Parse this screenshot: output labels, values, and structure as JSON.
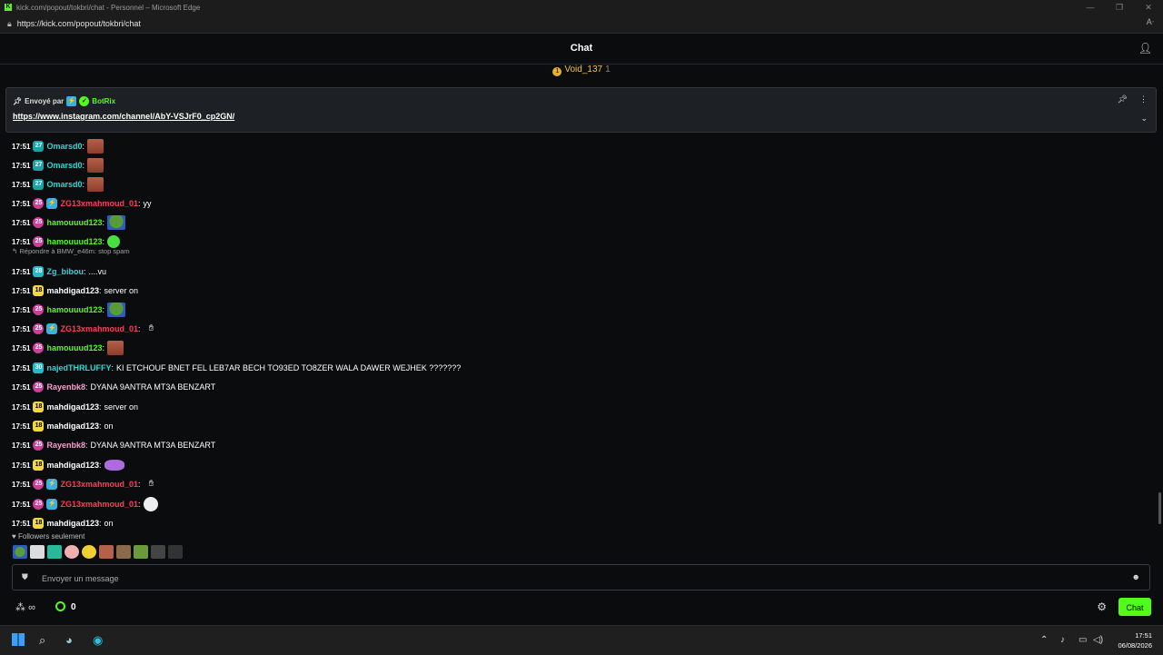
{
  "window": {
    "title": "kick.com/popout/tokbri/chat - Personnel – Microsoft Edge",
    "url": "https://kick.com/popout/tokbri/chat"
  },
  "chat": {
    "title": "Chat",
    "leaderboard": {
      "name": "Void_137",
      "count": "1"
    },
    "pinned": {
      "label": "Envoyé par",
      "sender": "BotRix",
      "link": "https://www.instagram.com/channel/AbY-VSJrF0_cp2GN/"
    },
    "reply": {
      "text": "Répondre à BMW_e46m: stop spam"
    },
    "messages": [
      {
        "time": "17:51",
        "badge": "27",
        "user": "Omarsd0",
        "color": "#2fd6d6",
        "text": "",
        "emote": "face"
      },
      {
        "time": "17:51",
        "badge": "27",
        "user": "Omarsd0",
        "color": "#2fd6d6",
        "text": "",
        "emote": "face"
      },
      {
        "time": "17:51",
        "badge": "27",
        "user": "Omarsd0",
        "color": "#2fd6d6",
        "text": "",
        "emote": "face"
      },
      {
        "time": "17:51",
        "badge": "25",
        "user": "ZG13xmahmoud_01",
        "color": "#ff3b5c",
        "text": "yy",
        "emote": ""
      },
      {
        "time": "17:51",
        "badge": "25",
        "user": "hamouuud123",
        "color": "#53fc18",
        "text": "",
        "emote": "pepe"
      },
      {
        "time": "17:51",
        "badge": "25",
        "user": "hamouuud123",
        "color": "#53fc18",
        "text": "",
        "emote": "green"
      },
      {
        "time": "17:51",
        "badge": "28",
        "user": "Zg_bibou",
        "color": "#2fd6d6",
        "text": "....vu",
        "emote": ""
      },
      {
        "time": "17:51",
        "badge": "18",
        "user": "mahdigad123",
        "color": "#ffffff",
        "text": "server on",
        "emote": ""
      },
      {
        "time": "17:51",
        "badge": "25",
        "user": "hamouuud123",
        "color": "#53fc18",
        "text": "",
        "emote": "pepe"
      },
      {
        "time": "17:51",
        "badge": "25",
        "user": "ZG13xmahmoud_01",
        "color": "#ff3b5c",
        "text": "",
        "emote": "hand"
      },
      {
        "time": "17:51",
        "badge": "25",
        "user": "hamouuud123",
        "color": "#53fc18",
        "text": "",
        "emote": "face"
      },
      {
        "time": "17:51",
        "badge": "30",
        "user": "najedTHRLUFFY",
        "color": "#2fd6d6",
        "text": "KI ETCHOUF BNET FEL LEB7AR BECH TO93ED TO8ZER WALA DAWER WEJHEK ???????",
        "emote": ""
      },
      {
        "time": "17:51",
        "badge": "25",
        "user": "Rayenbk8",
        "color": "#f5a0d0",
        "text": "DYANA 9ANTRA MT3A BENZART",
        "emote": ""
      },
      {
        "time": "17:51",
        "badge": "18",
        "user": "mahdigad123",
        "color": "#ffffff",
        "text": "server on",
        "emote": ""
      },
      {
        "time": "17:51",
        "badge": "18",
        "user": "mahdigad123",
        "color": "#ffffff",
        "text": "on",
        "emote": ""
      },
      {
        "time": "17:51",
        "badge": "25",
        "user": "Rayenbk8",
        "color": "#f5a0d0",
        "text": "DYANA 9ANTRA MT3A BENZART",
        "emote": ""
      },
      {
        "time": "17:51",
        "badge": "18",
        "user": "mahdigad123",
        "color": "#ffffff",
        "text": "",
        "emote": "purple"
      },
      {
        "time": "17:51",
        "badge": "25",
        "user": "ZG13xmahmoud_01",
        "color": "#ff3b5c",
        "text": "",
        "emote": "hand"
      },
      {
        "time": "17:51",
        "badge": "25",
        "user": "ZG13xmahmoud_01",
        "color": "#ff3b5c",
        "text": "",
        "emote": "troll"
      },
      {
        "time": "17:51",
        "badge": "18",
        "user": "mahdigad123",
        "color": "#ffffff",
        "text": "on",
        "emote": ""
      }
    ],
    "followers_label": "Followers seulement",
    "input_placeholder": "Envoyer un message",
    "points": "∞",
    "kick_coins": "0",
    "send_label": "Chat"
  },
  "taskbar": {
    "time": "17:51",
    "date": "06/08/2026"
  }
}
